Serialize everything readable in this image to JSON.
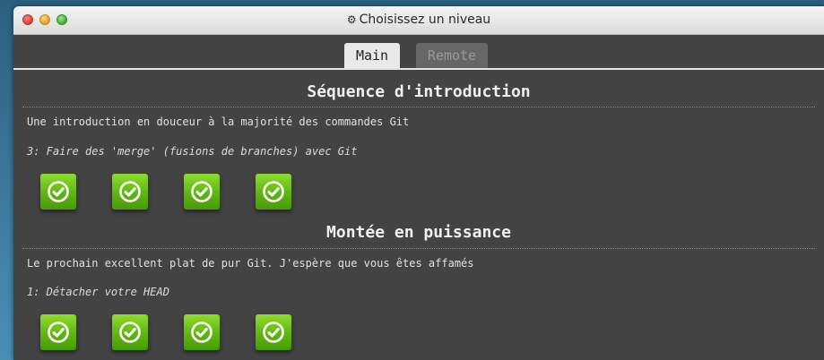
{
  "window": {
    "title": "Choisissez un niveau",
    "title_icon": "gear-icon"
  },
  "tabs": [
    {
      "label": "Main",
      "active": true
    },
    {
      "label": "Remote",
      "active": false
    }
  ],
  "sequences": [
    {
      "title": "Séquence d'introduction",
      "description": "Une introduction en douceur à la majorité des commandes Git",
      "level_label": "3: Faire des 'merge' (fusions de branches) avec Git",
      "levels": [
        {
          "status": "completed",
          "icon": "checkmark-icon"
        },
        {
          "status": "completed",
          "icon": "checkmark-icon"
        },
        {
          "status": "completed",
          "icon": "checkmark-icon"
        },
        {
          "status": "completed",
          "icon": "checkmark-icon"
        }
      ]
    },
    {
      "title": "Montée en puissance",
      "description": "Le prochain excellent plat de pur Git. J'espère que vous êtes affamés",
      "level_label": "1: Détacher votre HEAD",
      "levels": [
        {
          "status": "completed",
          "icon": "checkmark-icon"
        },
        {
          "status": "completed",
          "icon": "checkmark-icon"
        },
        {
          "status": "completed",
          "icon": "checkmark-icon"
        },
        {
          "status": "completed",
          "icon": "checkmark-icon"
        }
      ]
    }
  ],
  "colors": {
    "level_complete": "#6cc11a",
    "panel_bg": "#434343",
    "accent_text": "#f0f0f0"
  }
}
